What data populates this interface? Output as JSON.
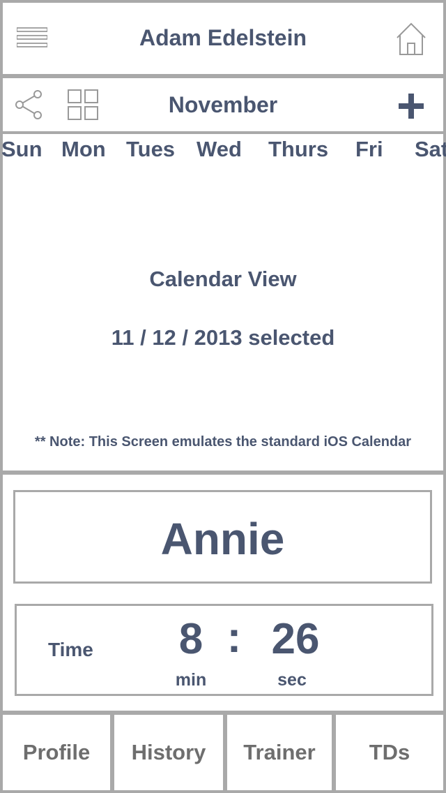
{
  "header": {
    "user_name": "Adam Edelstein",
    "menu_icon": "hamburger-menu-icon",
    "home_icon": "home-icon"
  },
  "toolbar": {
    "month": "November",
    "share_icon": "share-icon",
    "grid_icon": "grid-view-icon",
    "add_icon": "plus-icon"
  },
  "calendar": {
    "weekdays": [
      "Sun",
      "Mon",
      "Tues",
      "Wed",
      "Thurs",
      "Fri",
      "Sat"
    ],
    "title": "Calendar View",
    "selected": "11 / 12 / 2013 selected",
    "note": "** Note: This Screen emulates the standard iOS Calendar"
  },
  "workout": {
    "athlete": "Annie",
    "time_label": "Time",
    "minutes": "8",
    "separator": ":",
    "seconds": "26",
    "min_unit": "min",
    "sec_unit": "sec"
  },
  "tabs": [
    "Profile",
    "History",
    "Trainer",
    "TDs"
  ],
  "colors": {
    "text": "#4a5670",
    "tab_text": "#6e6e6e",
    "border": "#a9a9a9",
    "background": "#ffffff"
  }
}
